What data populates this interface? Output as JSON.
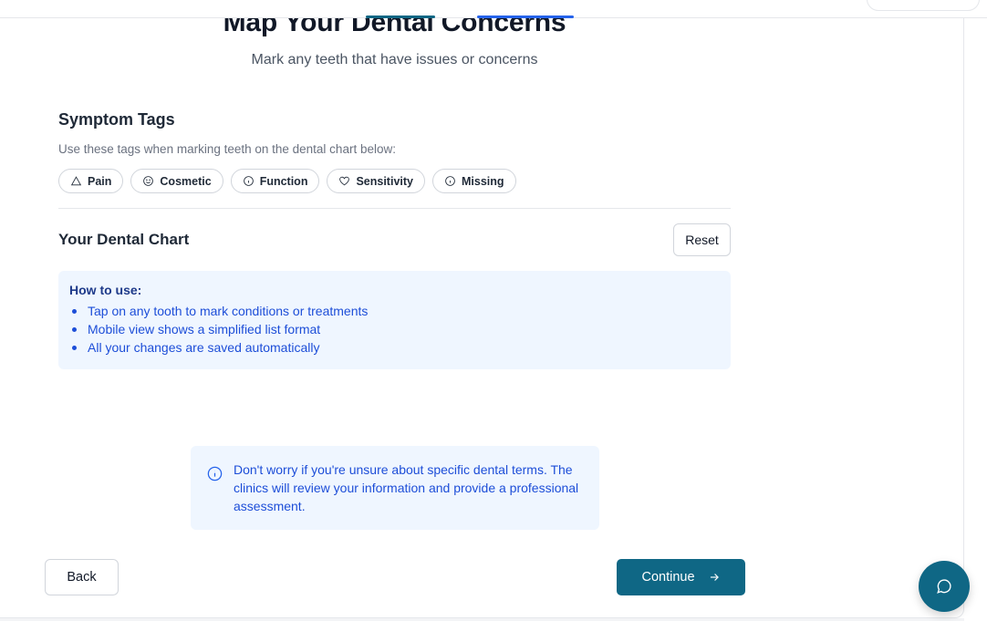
{
  "header": {
    "title": "Map Your Dental Concerns",
    "subtitle": "Mark any teeth that have issues or concerns"
  },
  "symptom_tags": {
    "title": "Symptom Tags",
    "description": "Use these tags when marking teeth on the dental chart below:",
    "tags": [
      {
        "label": "Pain",
        "icon": "warning-triangle-icon"
      },
      {
        "label": "Cosmetic",
        "icon": "smile-icon"
      },
      {
        "label": "Function",
        "icon": "info-circle-icon"
      },
      {
        "label": "Sensitivity",
        "icon": "heart-icon"
      },
      {
        "label": "Missing",
        "icon": "info-circle-icon"
      }
    ]
  },
  "dental_chart": {
    "title": "Your Dental Chart",
    "reset_label": "Reset",
    "howto": {
      "title": "How to use:",
      "items": [
        "Tap on any tooth to mark conditions or treatments",
        "Mobile view shows a simplified list format",
        "All your changes are saved automatically"
      ]
    }
  },
  "notice": {
    "icon": "info-circle-icon",
    "text": "Don't worry if you're unsure about specific dental terms. The clinics will review your information and provide a professional assessment."
  },
  "footer": {
    "back_label": "Back",
    "continue_label": "Continue",
    "continue_icon": "arrow-right-icon"
  },
  "chat": {
    "icon": "chat-bubble-icon"
  },
  "colors": {
    "primary": "#0f6785",
    "info_bg": "#eff6ff",
    "info_text": "#1d4ed8"
  }
}
